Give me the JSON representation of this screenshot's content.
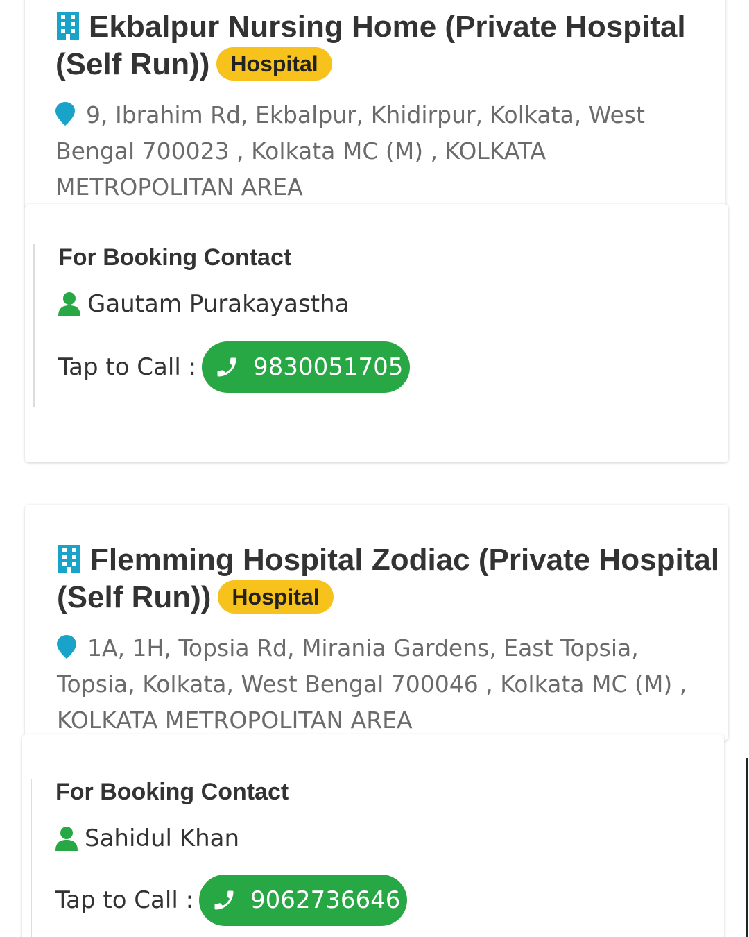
{
  "colors": {
    "badge": "#f8c21c",
    "call_button": "#28a745",
    "icon_teal": "#1aa3c8",
    "icon_green": "#28a745"
  },
  "cards": [
    {
      "name": "Ekbalpur Nursing Home (Private Hospital (Self Run))",
      "badge": "Hospital",
      "address": "9, Ibrahim Rd, Ekbalpur, Khidirpur, Kolkata, West Bengal 700023 , Kolkata MC (M) , KOLKATA METROPOLITAN AREA",
      "booking_heading": "For Booking Contact",
      "contact_person": "Gautam Purakayastha",
      "call_label": "Tap to Call :",
      "phone": "9830051705"
    },
    {
      "name": "Flemming Hospital Zodiac (Private Hospital (Self Run))",
      "badge": "Hospital",
      "address": "1A, 1H, Topsia Rd, Mirania Gardens, East Topsia, Topsia, Kolkata, West Bengal 700046 , Kolkata MC (M) , KOLKATA METROPOLITAN AREA",
      "booking_heading": "For Booking Contact",
      "contact_person": "Sahidul Khan",
      "call_label": "Tap to Call :",
      "phone": "9062736646"
    }
  ]
}
